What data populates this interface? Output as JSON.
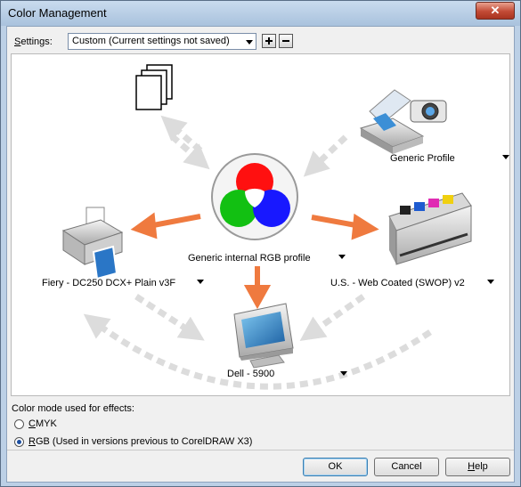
{
  "window": {
    "title": "Color Management",
    "close_label": "✕"
  },
  "settings": {
    "label_prefix": "S",
    "label_rest": "ettings:",
    "value": "Custom (Current settings not saved)"
  },
  "diagram": {
    "generic_profile": "Generic Profile",
    "internal_profile": "Generic internal RGB profile",
    "printer_profile": "Fiery - DC250 DCX+ Plain v3F",
    "press_profile": "U.S. - Web Coated (SWOP) v2",
    "monitor_profile": "Dell - 5900"
  },
  "color_mode": {
    "label": "Color mode used for effects:",
    "options": [
      {
        "prefix": "C",
        "rest": "MYK",
        "checked": false
      },
      {
        "prefix": "R",
        "rest": "GB (Used in versions previous to CorelDRAW X3)",
        "checked": true
      }
    ]
  },
  "buttons": {
    "ok": "OK",
    "cancel": "Cancel",
    "help_prefix": "H",
    "help_rest": "elp"
  },
  "colors": {
    "accent_arrow": "#ef7a3f",
    "gray_arrow": "#dcdcdc",
    "titlebar": "#b3cbe5"
  }
}
